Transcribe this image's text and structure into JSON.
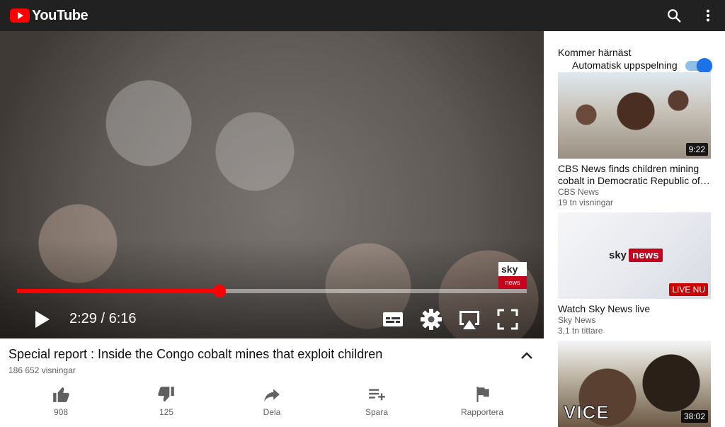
{
  "app": {
    "name": "YouTube"
  },
  "player": {
    "current_time": "2:29",
    "duration": "6:16",
    "time_display": "2:29 / 6:16",
    "progress_fraction": 0.397,
    "watermark_top": "sky",
    "watermark_bottom": "news"
  },
  "video": {
    "title": "Special report : Inside the Congo cobalt mines that exploit children",
    "views": "186 652 visningar"
  },
  "actions": [
    {
      "icon": "thumbs-up-icon",
      "label": "908"
    },
    {
      "icon": "thumbs-down-icon",
      "label": "125"
    },
    {
      "icon": "share-icon",
      "label": "Dela"
    },
    {
      "icon": "playlist-add-icon",
      "label": "Spara"
    },
    {
      "icon": "flag-icon",
      "label": "Rapportera"
    }
  ],
  "sidebar": {
    "up_next_label": "Kommer härnäst",
    "autoplay_label": "Automatisk uppspelning",
    "autoplay_on": true,
    "videos": [
      {
        "title": "CBS News finds children mining cobalt in Democratic Republic of Congo",
        "channel": "CBS News",
        "meta": "19 tn visningar",
        "duration": "9:22"
      },
      {
        "title": "Watch Sky News live",
        "channel": "Sky News",
        "meta": "3,1 tn tittare",
        "badge": "LIVE NU",
        "thumb_logo_a": "sky",
        "thumb_logo_b": "news"
      },
      {
        "duration": "38:02",
        "thumb_logo": "VICE"
      }
    ]
  },
  "colors": {
    "topbar": "#212121",
    "accent_red": "#ff0000",
    "toggle_blue": "#1a73e8"
  }
}
